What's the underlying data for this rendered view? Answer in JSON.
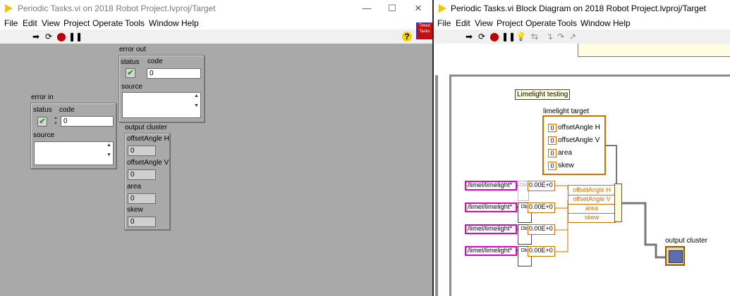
{
  "front_panel": {
    "title": "Periodic Tasks.vi on 2018 Robot Project.lvproj/Target",
    "window_buttons": {
      "minimize": "—",
      "maximize": "☐",
      "close": "✕"
    },
    "menu": [
      "File",
      "Edit",
      "View",
      "Project",
      "Operate",
      "Tools",
      "Window",
      "Help"
    ],
    "help_icon": "?",
    "vi_icon_text": "Timed Tasks",
    "error_out": {
      "label": "error out",
      "status_label": "status",
      "code_label": "code",
      "code_value": "0",
      "source_label": "source"
    },
    "error_in": {
      "label": "error in",
      "status_label": "status",
      "code_label": "code",
      "code_value": "0",
      "source_label": "source"
    },
    "output_cluster": {
      "label": "output cluster",
      "fields": [
        {
          "label": "offsetAngle H",
          "value": "0"
        },
        {
          "label": "offsetAngle V",
          "value": "0"
        },
        {
          "label": "area",
          "value": "0"
        },
        {
          "label": "skew",
          "value": "0"
        }
      ]
    }
  },
  "block_diagram": {
    "title": "Periodic Tasks.vi Block Diagram on 2018 Robot Project.lvproj/Target",
    "menu": [
      "File",
      "Edit",
      "View",
      "Project",
      "Operate",
      "Tools",
      "Window",
      "Help"
    ],
    "comment": "Limelight testing",
    "limelight_target": {
      "label": "limelight target",
      "fields": [
        "offsetAngle H",
        "offsetAngle V",
        "area",
        "skew"
      ],
      "field_prefix": "0"
    },
    "paths": [
      "/limel/limelight*",
      "/limel/limelight*",
      "/limel/limelight*",
      "/limel/limelight*"
    ],
    "dbl_label": "Dbl",
    "default_values": [
      "0.00E+0",
      "0.00E+0",
      "0.00E+0",
      "0.00E+0"
    ],
    "bundle_fields": [
      "offsetAngle H",
      "offsetAngle V",
      "area",
      "skew"
    ],
    "output_cluster_label": "output cluster"
  },
  "colors": {
    "panel_bg": "#a9a9a9",
    "accent_orange": "#d07000",
    "string_pink": "#e000c8",
    "wire_gray": "#777777"
  }
}
